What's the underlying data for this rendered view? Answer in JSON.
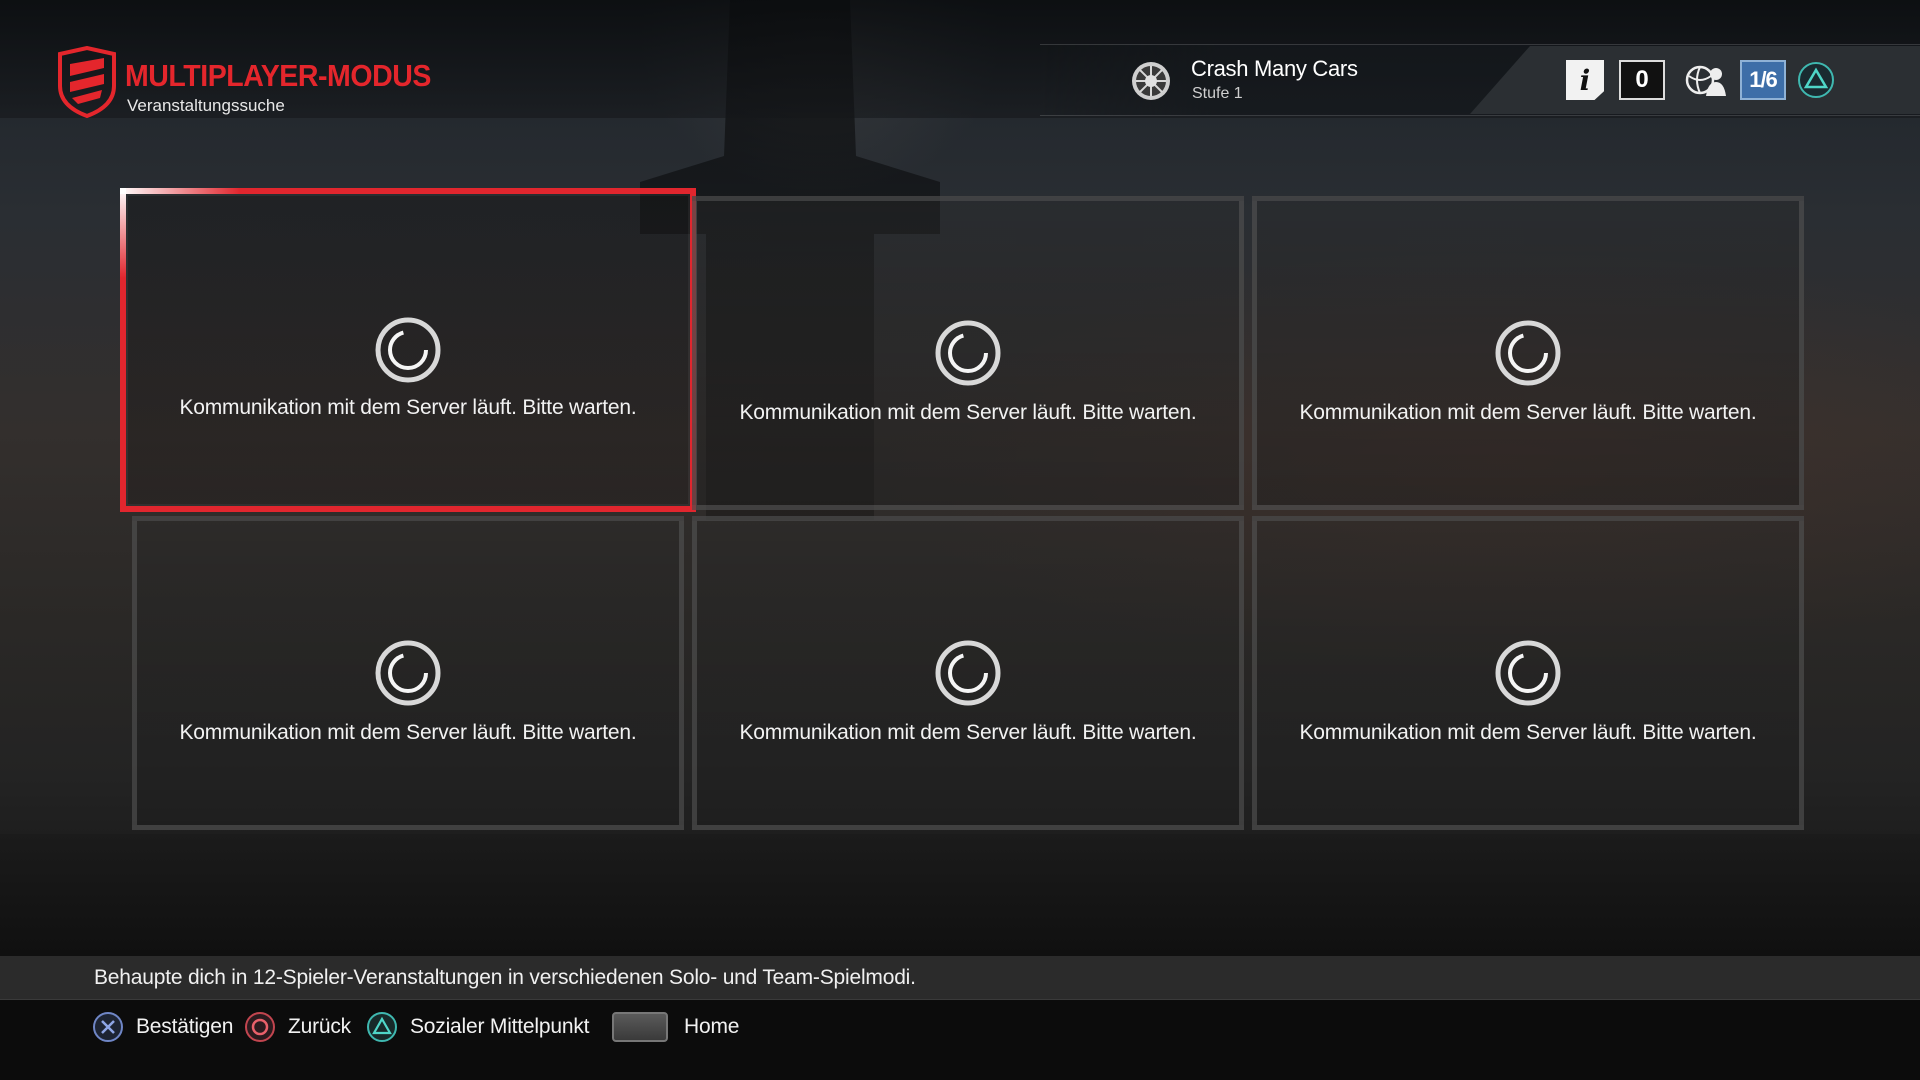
{
  "header": {
    "mode_title": "MULTIPLAYER-MODUS",
    "mode_subtitle": "Veranstaltungssuche",
    "logo_icon": "driveclub-shield-logo",
    "brand_color": "#e4262c"
  },
  "player": {
    "name": "Crash Many Cars",
    "level": "Stufe 1",
    "emblem_icon": "player-emblem-icon"
  },
  "hud": {
    "info_icon": "info-icon",
    "counter": "0",
    "social_icon": "friends-globe-icon",
    "page_indicator": "1/6",
    "triangle_icon": "triangle-button-icon",
    "page_accent": "#3d6ea8"
  },
  "tiles": [
    {
      "message": "Kommunikation mit dem Server läuft. Bitte warten.",
      "selected": true
    },
    {
      "message": "Kommunikation mit dem Server läuft. Bitte warten.",
      "selected": false
    },
    {
      "message": "Kommunikation mit dem Server läuft. Bitte warten.",
      "selected": false
    },
    {
      "message": "Kommunikation mit dem Server läuft. Bitte warten.",
      "selected": false
    },
    {
      "message": "Kommunikation mit dem Server läuft. Bitte warten.",
      "selected": false
    },
    {
      "message": "Kommunikation mit dem Server läuft. Bitte warten.",
      "selected": false
    }
  ],
  "description": "Behaupte dich in 12-Spieler-Veranstaltungen in verschiedenen Solo- und Team-Spielmodi.",
  "controls": [
    {
      "icon": "cross-button-icon",
      "label": "Bestätigen"
    },
    {
      "icon": "circle-button-icon",
      "label": "Zurück"
    },
    {
      "icon": "triangle-button-icon",
      "label": "Sozialer Mittelpunkt"
    },
    {
      "icon": "touchpad-button-icon",
      "label": "Home"
    }
  ]
}
